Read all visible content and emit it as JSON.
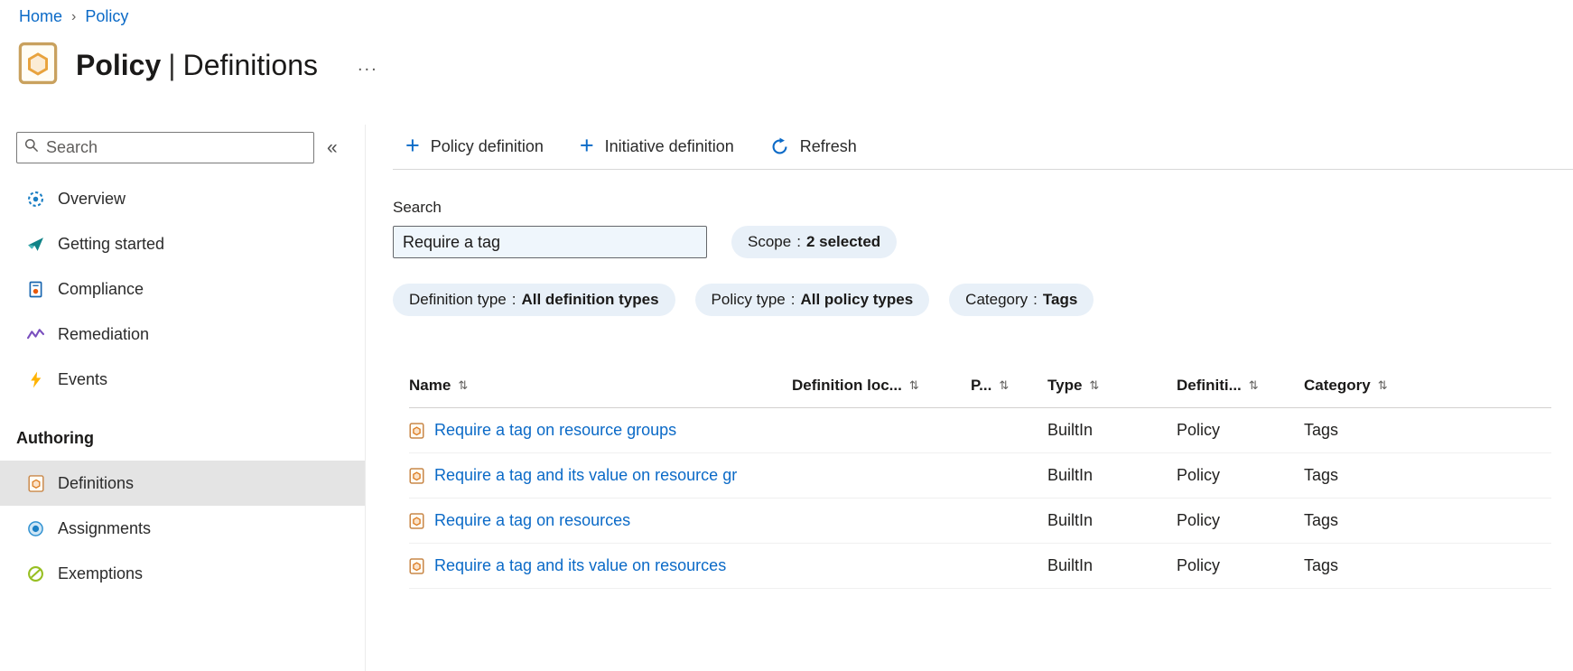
{
  "colors": {
    "link": "#0b6ac7",
    "accent": "#0078d4",
    "selected_bg": "#e4e4e4",
    "pill_bg": "#e8f0f8",
    "input_bg": "#eff6fc"
  },
  "breadcrumb": {
    "home": "Home",
    "separator": "›",
    "policy": "Policy"
  },
  "header": {
    "title_primary": "Policy",
    "title_separator": "|",
    "title_secondary": "Definitions",
    "more": "..."
  },
  "sidebar": {
    "search_placeholder": "Search",
    "collapse_icon": "«",
    "items": [
      {
        "label": "Overview"
      },
      {
        "label": "Getting started"
      },
      {
        "label": "Compliance"
      },
      {
        "label": "Remediation"
      },
      {
        "label": "Events"
      }
    ],
    "section_label": "Authoring",
    "authoring_items": [
      {
        "label": "Definitions"
      },
      {
        "label": "Assignments"
      },
      {
        "label": "Exemptions"
      }
    ]
  },
  "toolbar": {
    "plus_icon": "+",
    "policy_definition_label": "Policy definition",
    "initiative_definition_label": "Initiative definition",
    "refresh_label": "Refresh"
  },
  "filters": {
    "search_label": "Search",
    "search_value": "Require a tag",
    "separator": ":",
    "pills": [
      {
        "name": "Scope",
        "value": "2 selected"
      },
      {
        "name": "Definition type",
        "value": "All definition types"
      },
      {
        "name": "Policy type",
        "value": "All policy types"
      },
      {
        "name": "Category",
        "value": "Tags"
      }
    ]
  },
  "table": {
    "sort_icon": "⇅",
    "columns": [
      {
        "label": "Name"
      },
      {
        "label": "Definition loc..."
      },
      {
        "label": "P..."
      },
      {
        "label": "Type"
      },
      {
        "label": "Definiti..."
      },
      {
        "label": "Category"
      }
    ],
    "rows": [
      {
        "name": "Require a tag on resource groups",
        "type": "BuiltIn",
        "definition": "Policy",
        "category": "Tags"
      },
      {
        "name": "Require a tag and its value on resource gr",
        "type": "BuiltIn",
        "definition": "Policy",
        "category": "Tags"
      },
      {
        "name": "Require a tag on resources",
        "type": "BuiltIn",
        "definition": "Policy",
        "category": "Tags"
      },
      {
        "name": "Require a tag and its value on resources",
        "type": "BuiltIn",
        "definition": "Policy",
        "category": "Tags"
      }
    ]
  }
}
